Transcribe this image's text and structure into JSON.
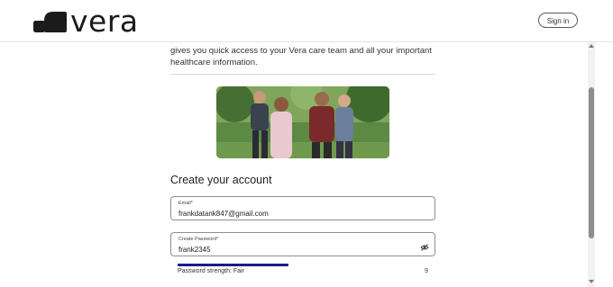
{
  "header": {
    "logo_text": "vera",
    "signin_label": "Sign in"
  },
  "intro": {
    "line1": "gives you quick access to your Vera care team and all your important",
    "line2": "healthcare information."
  },
  "form": {
    "title": "Create your account",
    "email": {
      "label": "Email*",
      "value": "frankdatank847@gmail.com"
    },
    "password": {
      "label": "Create Password*",
      "value": "frank2345"
    },
    "strength": {
      "label": "Password strength: Fair",
      "count": "9",
      "fill_percent": 42
    }
  },
  "icons": {
    "eye_toggle": "eye-slash-icon",
    "logo_mark": "vera-logo-icon"
  },
  "colors": {
    "strength_bar": "#1a1a8c",
    "text": "#222222"
  }
}
